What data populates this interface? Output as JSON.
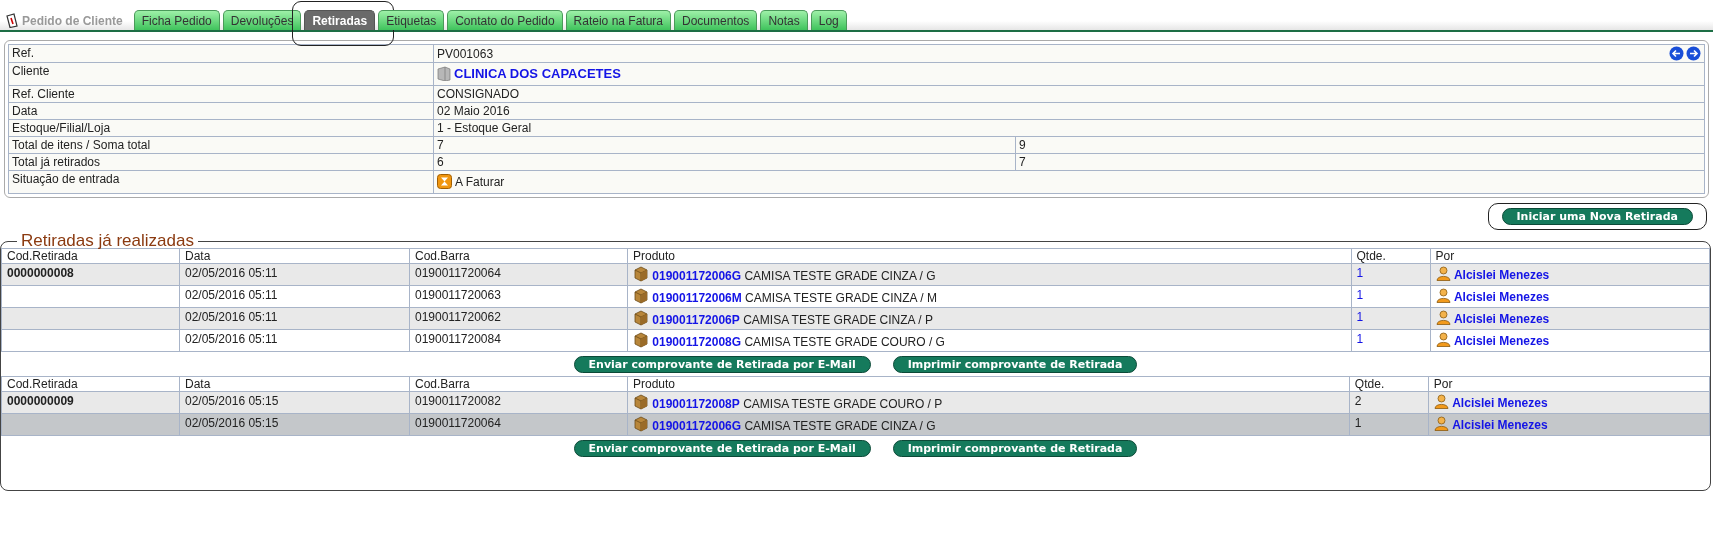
{
  "header": {
    "title": "Pedido de Cliente"
  },
  "tabs": [
    {
      "label": "Ficha Pedido",
      "selected": false,
      "highlighted": false
    },
    {
      "label": "Devoluções",
      "selected": false,
      "highlighted": false
    },
    {
      "label": "Retiradas",
      "selected": true,
      "highlighted": true
    },
    {
      "label": "Etiquetas",
      "selected": false,
      "highlighted": false
    },
    {
      "label": "Contato do Pedido",
      "selected": false,
      "highlighted": false
    },
    {
      "label": "Rateio na Fatura",
      "selected": false,
      "highlighted": false
    },
    {
      "label": "Documentos",
      "selected": false,
      "highlighted": false
    },
    {
      "label": "Notas",
      "selected": false,
      "highlighted": false
    },
    {
      "label": "Log",
      "selected": false,
      "highlighted": false
    }
  ],
  "info": [
    {
      "kind": "nav",
      "label": "Ref.",
      "values": [
        "PV001063"
      ]
    },
    {
      "kind": "client",
      "label": "Cliente",
      "values": [
        "CLINICA DOS CAPACETES"
      ]
    },
    {
      "kind": "text",
      "label": "Ref. Cliente",
      "values": [
        "CONSIGNADO"
      ]
    },
    {
      "kind": "text",
      "label": "Data",
      "values": [
        "02 Maio 2016"
      ]
    },
    {
      "kind": "text",
      "label": "Estoque/Filial/Loja",
      "values": [
        "1 - Estoque Geral"
      ]
    },
    {
      "kind": "text",
      "label": "Total de itens / Soma total",
      "values": [
        "7",
        "9"
      ]
    },
    {
      "kind": "text",
      "label": "Total já retirados",
      "values": [
        "6",
        "7"
      ]
    },
    {
      "kind": "status",
      "label": "Situação de entrada",
      "values": [
        "A Faturar"
      ]
    }
  ],
  "new_button": {
    "label": "Iniciar uma Nova Retirada",
    "highlighted": true
  },
  "section": {
    "title": "Retiradas já realizadas",
    "groups": [
      {
        "columns": [
          "Cod.Retirada",
          "Data",
          "Cod.Barra",
          "Produto",
          "Qtde.",
          "Por"
        ],
        "code": "0000000008",
        "qty_link": true,
        "rows": [
          {
            "date": "02/05/2016 05:11",
            "barcode": "0190011720064",
            "product_code": "019001172006G",
            "product_name": "CAMISA TESTE GRADE CINZA / G",
            "qty": "1",
            "by": "Alcislei Menezes",
            "selected": false
          },
          {
            "date": "02/05/2016 05:11",
            "barcode": "0190011720063",
            "product_code": "019001172006M",
            "product_name": "CAMISA TESTE GRADE CINZA / M",
            "qty": "1",
            "by": "Alcislei Menezes",
            "selected": false
          },
          {
            "date": "02/05/2016 05:11",
            "barcode": "0190011720062",
            "product_code": "019001172006P",
            "product_name": "CAMISA TESTE GRADE CINZA / P",
            "qty": "1",
            "by": "Alcislei Menezes",
            "selected": false
          },
          {
            "date": "02/05/2016 05:11",
            "barcode": "0190011720084",
            "product_code": "019001172008G",
            "product_name": "CAMISA TESTE GRADE COURO / G",
            "qty": "1",
            "by": "Alcislei Menezes",
            "selected": false
          }
        ],
        "buttons": [
          "Enviar comprovante de Retirada por E-Mail",
          "Imprimir comprovante de Retirada"
        ]
      },
      {
        "columns": [
          "Cod.Retirada",
          "Data",
          "Cod.Barra",
          "Produto",
          "Qtde.",
          "Por"
        ],
        "code": "0000000009",
        "qty_link": false,
        "rows": [
          {
            "date": "02/05/2016 05:15",
            "barcode": "0190011720082",
            "product_code": "019001172008P",
            "product_name": "CAMISA TESTE GRADE COURO / P",
            "qty": "2",
            "by": "Alcislei Menezes",
            "selected": false
          },
          {
            "date": "02/05/2016 05:15",
            "barcode": "0190011720064",
            "product_code": "019001172006G",
            "product_name": "CAMISA TESTE GRADE CINZA / G",
            "qty": "1",
            "by": "Alcislei Menezes",
            "selected": true
          }
        ],
        "buttons": [
          "Enviar comprovante de Retirada por E-Mail",
          "Imprimir comprovante de Retirada"
        ]
      }
    ]
  }
}
